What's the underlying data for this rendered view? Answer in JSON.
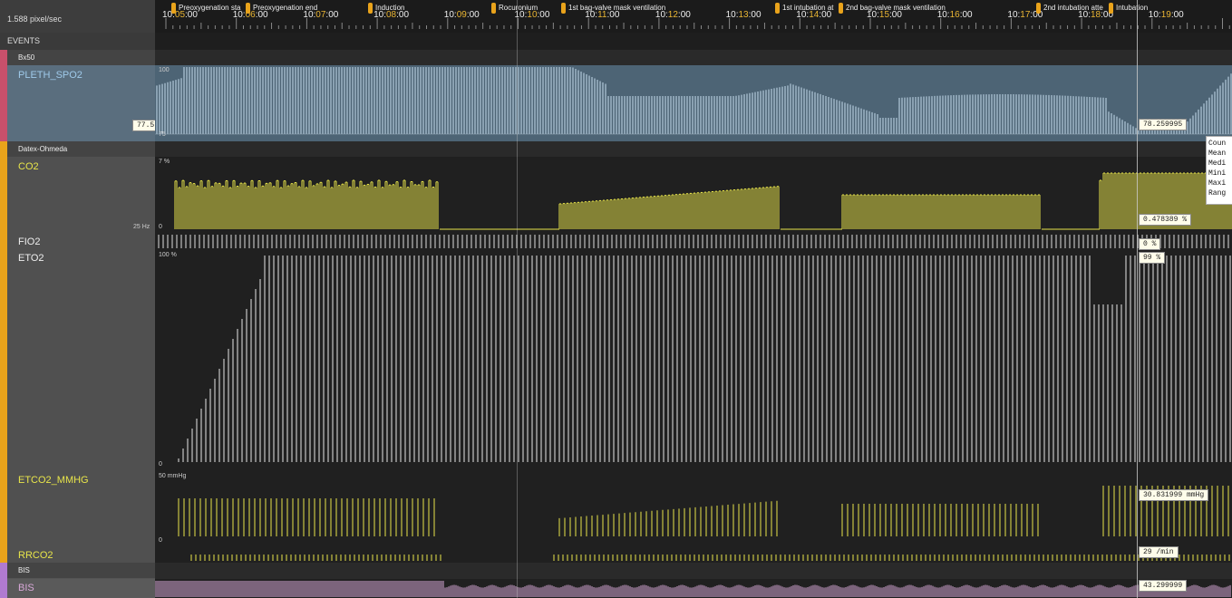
{
  "scale": "1.588 pixel/sec",
  "events_label": "EVENTS",
  "timeline": {
    "ticks": [
      {
        "h": "10:",
        "m": "05",
        "s": ":00"
      },
      {
        "h": "10:",
        "m": "06",
        "s": ":00"
      },
      {
        "h": "10:",
        "m": "07",
        "s": ":00"
      },
      {
        "h": "10:",
        "m": "08",
        "s": ":00"
      },
      {
        "h": "10:",
        "m": "09",
        "s": ":00"
      },
      {
        "h": "10:",
        "m": "10",
        "s": ":00"
      },
      {
        "h": "10:",
        "m": "11",
        "s": ":00"
      },
      {
        "h": "10:",
        "m": "12",
        "s": ":00"
      },
      {
        "h": "10:",
        "m": "13",
        "s": ":00"
      },
      {
        "h": "10:",
        "m": "14",
        "s": ":00"
      },
      {
        "h": "10:",
        "m": "15",
        "s": ":00"
      },
      {
        "h": "10:",
        "m": "16",
        "s": ":00"
      },
      {
        "h": "10:",
        "m": "17",
        "s": ":00"
      },
      {
        "h": "10:",
        "m": "18",
        "s": ":00"
      },
      {
        "h": "10:",
        "m": "19",
        "s": ":00"
      }
    ]
  },
  "events": [
    "Preoxygenation sta",
    "Preoxygenation end",
    "Induction",
    "Rocuronium",
    "1st bag-valve mask ventilation",
    "1st intubation at",
    "2nd bag-valve mask ventilation",
    "2nd intubation atte",
    "Intubation"
  ],
  "groups": {
    "bx50": "Bx50",
    "datex": "Datex-Ohmeda",
    "bis": "BIS"
  },
  "tracks": {
    "pleth": {
      "name": "PLETH_SPO2",
      "left_value": "77.5",
      "value": "78.259995",
      "axis_top": "100",
      "axis_bottom": "75"
    },
    "co2": {
      "name": "CO2",
      "value": "0.478389 %",
      "axis_top": "7 %",
      "axis_bottom": "0",
      "rate": "25 Hz"
    },
    "fio2": {
      "name": "FIO2",
      "value": "0 %"
    },
    "eto2": {
      "name": "ETO2",
      "value": "99 %",
      "axis_top": "100 %",
      "axis_bottom": "0"
    },
    "etco2": {
      "name": "ETCO2_MMHG",
      "value": "30.831999 mmHg",
      "axis_top": "50 mmHg",
      "axis_bottom": "0"
    },
    "rrco2": {
      "name": "RRCO2",
      "value": "29 /min"
    },
    "bis": {
      "name": "BIS",
      "value": "43.299999"
    }
  },
  "tooltip": [
    "Coun",
    "Mean",
    "Medi",
    "Mini",
    "Maxi",
    "Rang"
  ],
  "colors": {
    "bx50": "#c8506b",
    "datex": "#e9a31b",
    "bis": "#b07ad0",
    "pleth_wave": "#b8d4ea",
    "pleth_bg": "#4d6475",
    "co2_wave": "#e8e54a",
    "eto2_wave": "#e8e8e8",
    "bis_wave": "#d8a8d8",
    "event_tab": "#e9a31b"
  }
}
